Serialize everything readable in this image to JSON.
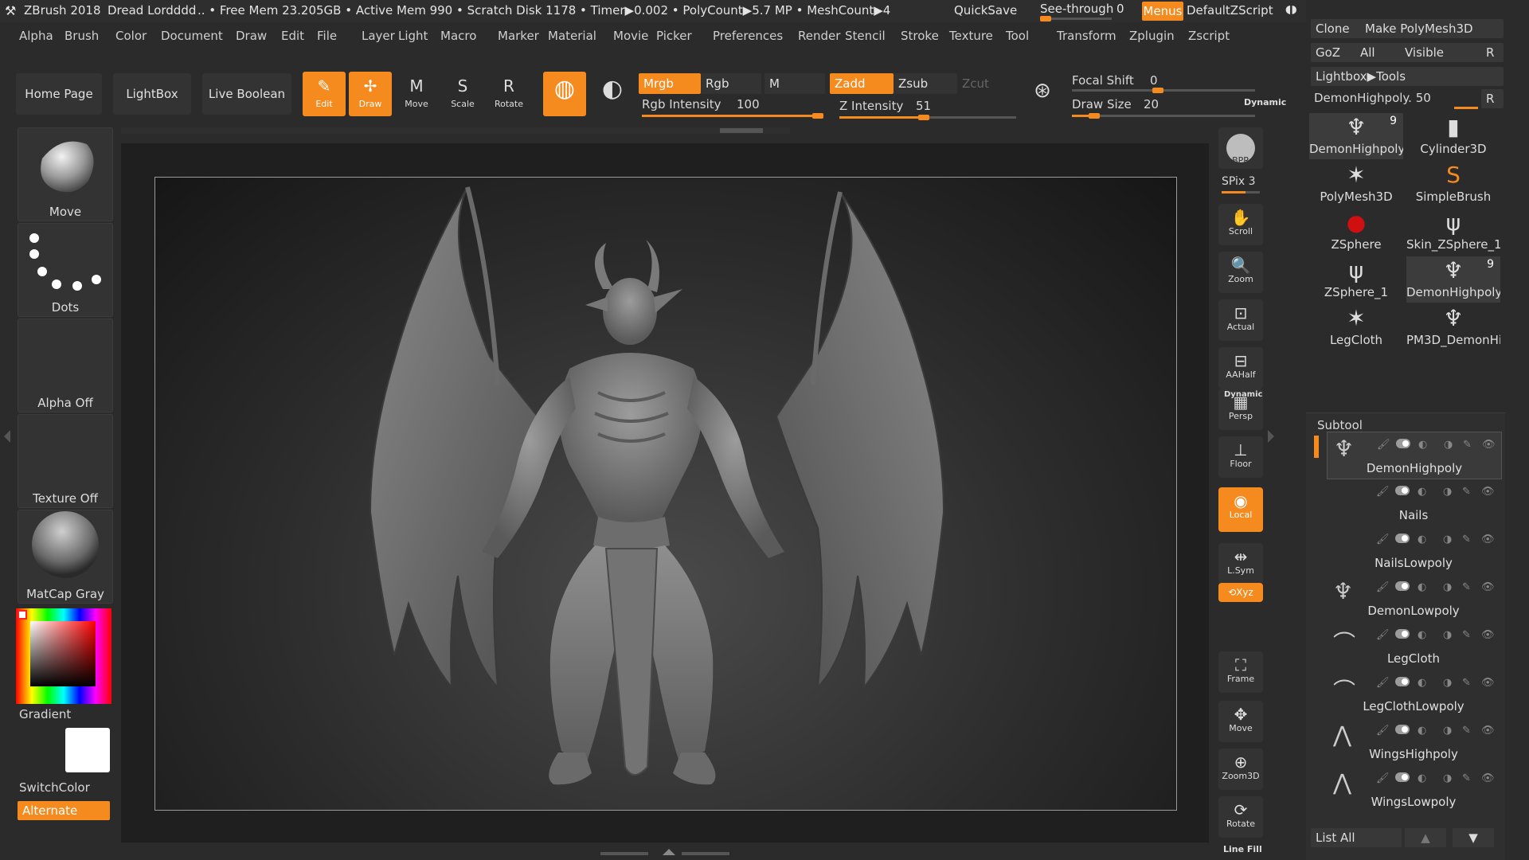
{
  "title_bar": {
    "app": "ZBrush 2018",
    "project": "Dread Lordddd",
    "stats": ".. • Free Mem 23.205GB • Active Mem 990 • Scratch Disk 1178 •  Timer▶0.002 • PolyCount▶5.7 MP  • MeshCount▶4",
    "quicksave": "QuickSave",
    "see_through_label": "See-through",
    "see_through_value": "0",
    "menus": "Menus",
    "script": "DefaultZScript"
  },
  "menu": [
    "Alpha",
    "Brush",
    "Color",
    "Document",
    "Draw",
    "Edit",
    "File",
    "Layer",
    "Light",
    "Macro",
    "Marker",
    "Material",
    "Movie",
    "Picker",
    "Preferences",
    "Render",
    "Stencil",
    "Stroke",
    "Texture",
    "Tool",
    "Transform",
    "Zplugin",
    "Zscript"
  ],
  "toolbar": {
    "home": "Home Page",
    "lightbox": "LightBox",
    "live_boolean": "Live Boolean",
    "tools": [
      {
        "label": "Edit",
        "glyph": "✎",
        "on": true
      },
      {
        "label": "Draw",
        "glyph": "✢",
        "on": true
      },
      {
        "label": "Move",
        "glyph": "M",
        "on": false
      },
      {
        "label": "Scale",
        "glyph": "S",
        "on": false
      },
      {
        "label": "Rotate",
        "glyph": "R",
        "on": false
      }
    ],
    "mrgb": "Mrgb",
    "rgb": "Rgb",
    "m": "M",
    "zadd": "Zadd",
    "zsub": "Zsub",
    "zcut": "Zcut",
    "rgb_intensity_label": "Rgb Intensity",
    "rgb_intensity": "100",
    "rgb_intensity_fraction": 1.0,
    "z_intensity_label": "Z Intensity",
    "z_intensity": "51",
    "z_intensity_fraction": 0.51,
    "focal_shift_label": "Focal Shift",
    "focal_shift": "0",
    "focal_shift_fraction": 0.5,
    "draw_size_label": "Draw Size",
    "draw_size": "20",
    "draw_size_fraction": 0.15,
    "dynamic": "Dynamic"
  },
  "left_shelf": {
    "brush": "Move",
    "stroke": "Dots",
    "alpha": "Alpha Off",
    "texture": "Texture Off",
    "material": "MatCap Gray",
    "gradient": "Gradient",
    "switch_color": "SwitchColor",
    "alternate": "Alternate"
  },
  "right_shelf": {
    "bpr": "BPR",
    "spix": "SPix 3",
    "buttons": [
      {
        "label": "Scroll",
        "glyph": "✋",
        "on": false
      },
      {
        "label": "Zoom",
        "glyph": "🔍",
        "on": false
      },
      {
        "label": "Actual",
        "glyph": "⊡",
        "on": false
      },
      {
        "label": "AAHalf",
        "glyph": "⊟",
        "on": false
      },
      {
        "label": "Persp",
        "glyph": "▦",
        "on": false
      },
      {
        "label": "Floor",
        "glyph": "⊥",
        "on": false
      },
      {
        "label": "Local",
        "glyph": "◉",
        "on": true
      },
      {
        "label": "L.Sym",
        "glyph": "⇹",
        "on": false
      },
      {
        "label": "Xyz",
        "glyph": "⟲",
        "on": true
      },
      {
        "label": "Frame",
        "glyph": "⛶",
        "on": false
      },
      {
        "label": "Move",
        "glyph": "✥",
        "on": false
      },
      {
        "label": "Zoom3D",
        "glyph": "⊕",
        "on": false
      },
      {
        "label": "Rotate",
        "glyph": "⟳",
        "on": false
      }
    ],
    "dynamic": "Dynamic",
    "line_fill": "Line Fill"
  },
  "palette": {
    "clone": "Clone",
    "make_polymesh": "Make PolyMesh3D",
    "goz": "GoZ",
    "all": "All",
    "visible": "Visible",
    "r": "R",
    "lightbox_tools": "Lightbox▶Tools",
    "current_tool": "DemonHighpoly. 50",
    "tools": [
      {
        "name": "DemonHighpoly",
        "count": "9",
        "glyph": "♆",
        "sel": true
      },
      {
        "name": "Cylinder3D",
        "count": "",
        "glyph": "▮",
        "sel": false
      },
      {
        "name": "PolyMesh3D",
        "count": "",
        "glyph": "✶",
        "sel": false
      },
      {
        "name": "SimpleBrush",
        "count": "",
        "glyph": "S",
        "sel": false
      },
      {
        "name": "ZSphere",
        "count": "",
        "glyph": "●",
        "sel": false
      },
      {
        "name": "Skin_ZSphere_1",
        "count": "",
        "glyph": "ψ",
        "sel": false
      },
      {
        "name": "ZSphere_1",
        "count": "",
        "glyph": "ψ",
        "sel": false
      },
      {
        "name": "DemonHighpoly",
        "count": "9",
        "glyph": "♆",
        "sel": true
      },
      {
        "name": "LegCloth",
        "count": "",
        "glyph": "✶",
        "sel": false
      },
      {
        "name": "PM3D_DemonHi",
        "count": "",
        "glyph": "♆",
        "sel": false
      }
    ],
    "subtool_title": "Subtool",
    "subtools": [
      "DemonHighpoly",
      "Nails",
      "NailsLowpoly",
      "DemonLowpoly",
      "LegCloth",
      "LegClothLowpoly",
      "WingsHighpoly",
      "WingsLowpoly"
    ],
    "list_all": "List All"
  },
  "colors": {
    "accent": "#f58b1f",
    "panel": "#2b2b2b",
    "button": "#333333"
  }
}
